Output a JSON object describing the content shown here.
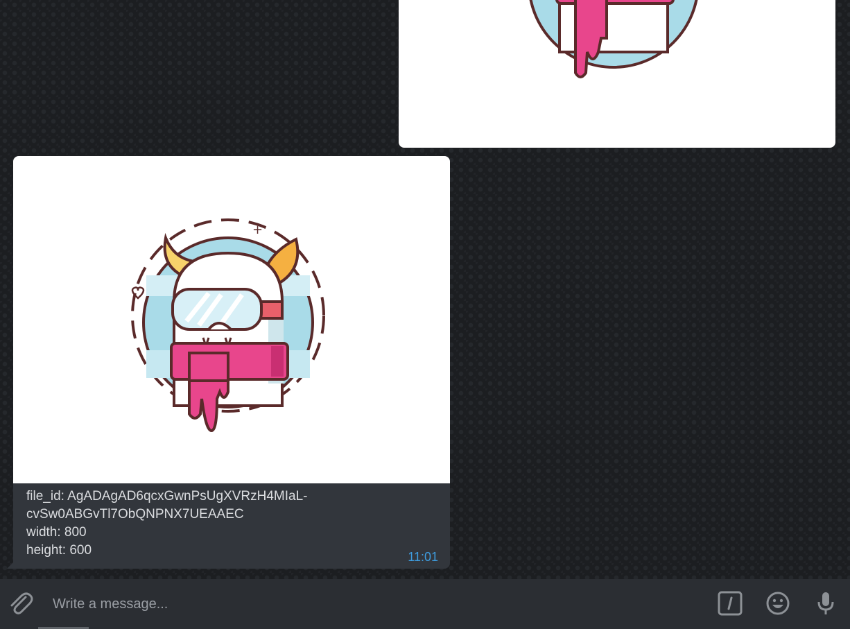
{
  "messages": {
    "outgoing_photo": {
      "image": "devil-character-photo"
    },
    "incoming": {
      "image": "devil-character-photo",
      "caption_lines": [
        "file_id: AgADAgAD6qcxGwnPsUgXVRzH4MIaL-",
        "cvSw0ABGvTl7ObQNPNX7UEAAEC",
        "width: 800",
        "height: 600"
      ],
      "time": "11:01"
    }
  },
  "composer": {
    "placeholder": "Write a message...",
    "icons": [
      "paperclip-icon",
      "slash-command-icon",
      "emoji-icon",
      "microphone-icon"
    ]
  },
  "colors": {
    "background": "#1c1e21",
    "incoming_bubble": "#32363c",
    "time": "#3e9de0",
    "composer": "#2b2e33",
    "scarf_pink": "#e8468c",
    "horn_orange": "#f5b041",
    "circle_blue": "#a9dbe8"
  }
}
